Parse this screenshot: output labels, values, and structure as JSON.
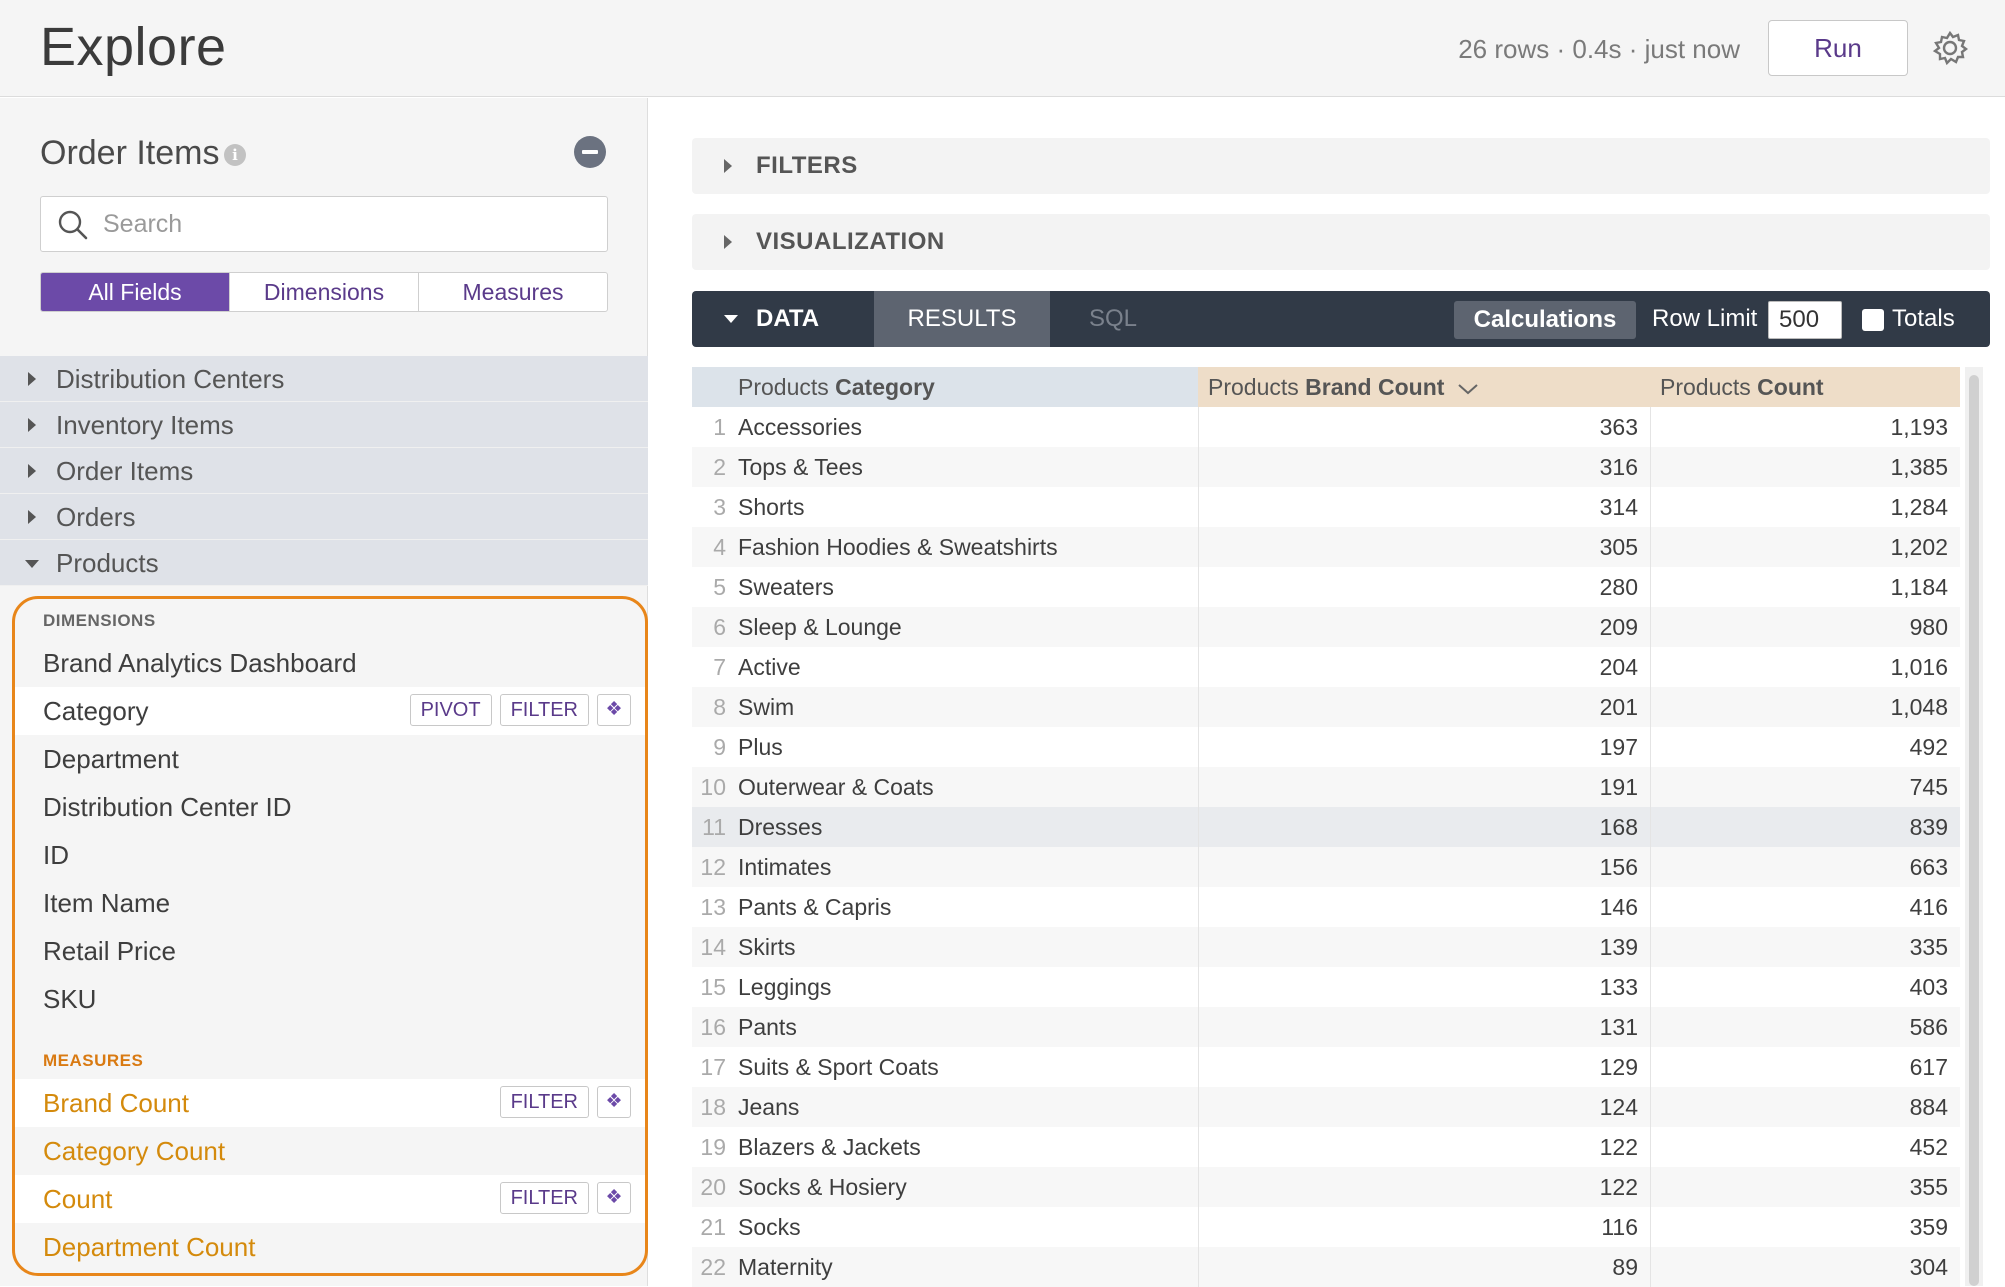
{
  "header": {
    "title": "Explore",
    "status": "26 rows · 0.4s · just now",
    "run_label": "Run"
  },
  "sidebar": {
    "explore_name": "Order Items",
    "info_icon": "i",
    "search_placeholder": "Search",
    "tabs": [
      "All Fields",
      "Dimensions",
      "Measures"
    ],
    "views": [
      "Distribution Centers",
      "Inventory Items",
      "Order Items",
      "Orders",
      "Products"
    ],
    "dimensions_label": "DIMENSIONS",
    "dimensions": [
      "Brand Analytics Dashboard",
      "Category",
      "Department",
      "Distribution Center ID",
      "ID",
      "Item Name",
      "Retail Price",
      "SKU"
    ],
    "measures_label": "MEASURES",
    "measures": [
      "Brand Count",
      "Category Count",
      "Count",
      "Department Count"
    ],
    "pivot_label": "PIVOT",
    "filter_label": "FILTER",
    "accent_color": "#e8861a"
  },
  "main": {
    "filters_label": "FILTERS",
    "visualization_label": "VISUALIZATION",
    "data_label": "DATA",
    "results_label": "RESULTS",
    "sql_label": "SQL",
    "calculations_label": "Calculations",
    "row_limit_label": "Row Limit",
    "row_limit_value": "500",
    "totals_label": "Totals"
  },
  "table": {
    "columns": [
      {
        "view": "Products",
        "field": "Category"
      },
      {
        "view": "Products",
        "field": "Brand Count"
      },
      {
        "view": "Products",
        "field": "Count"
      }
    ],
    "rows": [
      [
        "1",
        "Accessories",
        "363",
        "1,193"
      ],
      [
        "2",
        "Tops & Tees",
        "316",
        "1,385"
      ],
      [
        "3",
        "Shorts",
        "314",
        "1,284"
      ],
      [
        "4",
        "Fashion Hoodies & Sweatshirts",
        "305",
        "1,202"
      ],
      [
        "5",
        "Sweaters",
        "280",
        "1,184"
      ],
      [
        "6",
        "Sleep & Lounge",
        "209",
        "980"
      ],
      [
        "7",
        "Active",
        "204",
        "1,016"
      ],
      [
        "8",
        "Swim",
        "201",
        "1,048"
      ],
      [
        "9",
        "Plus",
        "197",
        "492"
      ],
      [
        "10",
        "Outerwear & Coats",
        "191",
        "745"
      ],
      [
        "11",
        "Dresses",
        "168",
        "839"
      ],
      [
        "12",
        "Intimates",
        "156",
        "663"
      ],
      [
        "13",
        "Pants & Capris",
        "146",
        "416"
      ],
      [
        "14",
        "Skirts",
        "139",
        "335"
      ],
      [
        "15",
        "Leggings",
        "133",
        "403"
      ],
      [
        "16",
        "Pants",
        "131",
        "586"
      ],
      [
        "17",
        "Suits & Sport Coats",
        "129",
        "617"
      ],
      [
        "18",
        "Jeans",
        "124",
        "884"
      ],
      [
        "19",
        "Blazers & Jackets",
        "122",
        "452"
      ],
      [
        "20",
        "Socks & Hosiery",
        "122",
        "355"
      ],
      [
        "21",
        "Socks",
        "116",
        "359"
      ],
      [
        "22",
        "Maternity",
        "89",
        "304"
      ]
    ]
  }
}
